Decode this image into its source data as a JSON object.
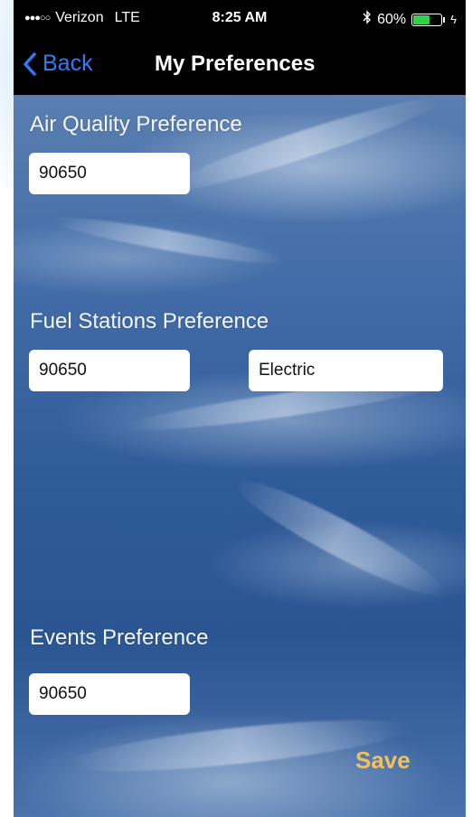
{
  "status_bar": {
    "signal": "●●●○○",
    "carrier": "Verizon",
    "network": "LTE",
    "time": "8:25 AM",
    "battery": "60%",
    "battery_level": 0.6,
    "battery_color": "#35d04a"
  },
  "nav": {
    "back_label": "Back",
    "title": "My Preferences",
    "accent": "#2f7bf5"
  },
  "air_quality": {
    "label": "Air Quality Preference",
    "zip_value": "90650"
  },
  "fuel_stations": {
    "label": "Fuel Stations Preference",
    "zip_value": "90650",
    "fuel_type_value": "Electric"
  },
  "events": {
    "label": "Events Preference",
    "zip_value": "90650"
  },
  "save_label": "Save",
  "save_color": "#f2c159"
}
